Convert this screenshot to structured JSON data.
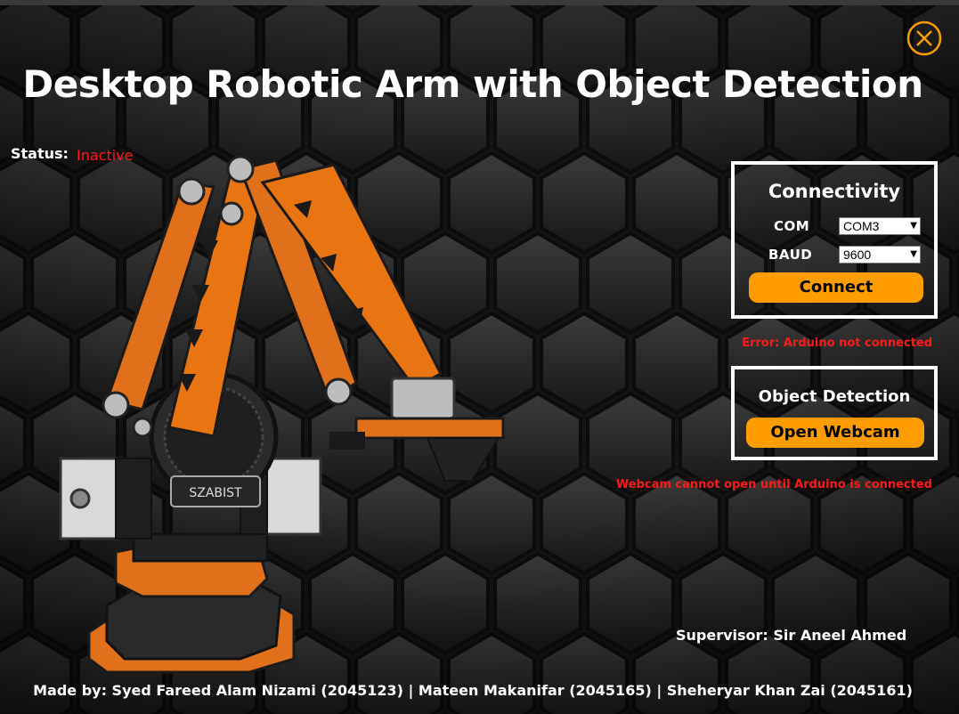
{
  "window": {
    "title": "Desktop Robotic Arm with Object Detection"
  },
  "status": {
    "label": "Status:",
    "value": "Inactive",
    "value_color": "#ff1a1a"
  },
  "robot_image": {
    "base_label": "SZABIST"
  },
  "connectivity": {
    "title": "Connectivity",
    "com_label": "COM",
    "com_value": "COM3",
    "baud_label": "BAUD",
    "baud_value": "9600",
    "connect_label": "Connect",
    "error": "Error: Arduino not connected"
  },
  "object_detection": {
    "title": "Object Detection",
    "webcam_label": "Open Webcam",
    "error": "Webcam cannot open until Arduino is connected"
  },
  "footer": {
    "supervisor": "Supervisor: Sir Aneel Ahmed",
    "made_by": "Made by: Syed Fareed Alam Nizami (2045123) | Mateen Makanifar (2045165) | Sheheryar Khan Zai (2045161)"
  },
  "colors": {
    "accent": "#ff9c00",
    "error": "#ff1a1a",
    "background": "#1b1b1b",
    "robot_orange": "#e66e0a"
  }
}
